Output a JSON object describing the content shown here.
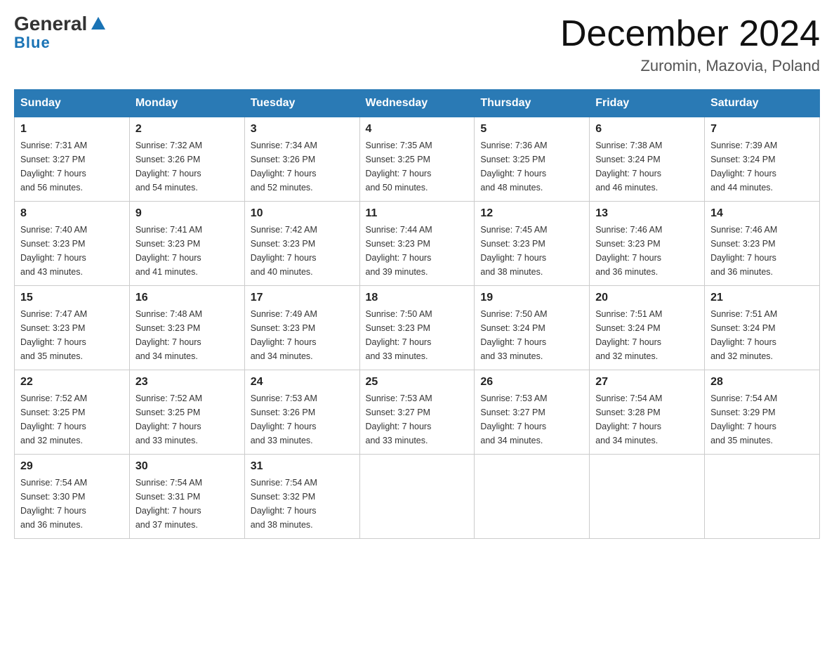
{
  "logo": {
    "general": "General",
    "triangle": "▶",
    "blue": "Blue"
  },
  "title": {
    "month_year": "December 2024",
    "location": "Zuromin, Mazovia, Poland"
  },
  "headers": [
    "Sunday",
    "Monday",
    "Tuesday",
    "Wednesday",
    "Thursday",
    "Friday",
    "Saturday"
  ],
  "weeks": [
    [
      {
        "day": "1",
        "sunrise": "7:31 AM",
        "sunset": "3:27 PM",
        "daylight": "7 hours and 56 minutes."
      },
      {
        "day": "2",
        "sunrise": "7:32 AM",
        "sunset": "3:26 PM",
        "daylight": "7 hours and 54 minutes."
      },
      {
        "day": "3",
        "sunrise": "7:34 AM",
        "sunset": "3:26 PM",
        "daylight": "7 hours and 52 minutes."
      },
      {
        "day": "4",
        "sunrise": "7:35 AM",
        "sunset": "3:25 PM",
        "daylight": "7 hours and 50 minutes."
      },
      {
        "day": "5",
        "sunrise": "7:36 AM",
        "sunset": "3:25 PM",
        "daylight": "7 hours and 48 minutes."
      },
      {
        "day": "6",
        "sunrise": "7:38 AM",
        "sunset": "3:24 PM",
        "daylight": "7 hours and 46 minutes."
      },
      {
        "day": "7",
        "sunrise": "7:39 AM",
        "sunset": "3:24 PM",
        "daylight": "7 hours and 44 minutes."
      }
    ],
    [
      {
        "day": "8",
        "sunrise": "7:40 AM",
        "sunset": "3:23 PM",
        "daylight": "7 hours and 43 minutes."
      },
      {
        "day": "9",
        "sunrise": "7:41 AM",
        "sunset": "3:23 PM",
        "daylight": "7 hours and 41 minutes."
      },
      {
        "day": "10",
        "sunrise": "7:42 AM",
        "sunset": "3:23 PM",
        "daylight": "7 hours and 40 minutes."
      },
      {
        "day": "11",
        "sunrise": "7:44 AM",
        "sunset": "3:23 PM",
        "daylight": "7 hours and 39 minutes."
      },
      {
        "day": "12",
        "sunrise": "7:45 AM",
        "sunset": "3:23 PM",
        "daylight": "7 hours and 38 minutes."
      },
      {
        "day": "13",
        "sunrise": "7:46 AM",
        "sunset": "3:23 PM",
        "daylight": "7 hours and 36 minutes."
      },
      {
        "day": "14",
        "sunrise": "7:46 AM",
        "sunset": "3:23 PM",
        "daylight": "7 hours and 36 minutes."
      }
    ],
    [
      {
        "day": "15",
        "sunrise": "7:47 AM",
        "sunset": "3:23 PM",
        "daylight": "7 hours and 35 minutes."
      },
      {
        "day": "16",
        "sunrise": "7:48 AM",
        "sunset": "3:23 PM",
        "daylight": "7 hours and 34 minutes."
      },
      {
        "day": "17",
        "sunrise": "7:49 AM",
        "sunset": "3:23 PM",
        "daylight": "7 hours and 34 minutes."
      },
      {
        "day": "18",
        "sunrise": "7:50 AM",
        "sunset": "3:23 PM",
        "daylight": "7 hours and 33 minutes."
      },
      {
        "day": "19",
        "sunrise": "7:50 AM",
        "sunset": "3:24 PM",
        "daylight": "7 hours and 33 minutes."
      },
      {
        "day": "20",
        "sunrise": "7:51 AM",
        "sunset": "3:24 PM",
        "daylight": "7 hours and 32 minutes."
      },
      {
        "day": "21",
        "sunrise": "7:51 AM",
        "sunset": "3:24 PM",
        "daylight": "7 hours and 32 minutes."
      }
    ],
    [
      {
        "day": "22",
        "sunrise": "7:52 AM",
        "sunset": "3:25 PM",
        "daylight": "7 hours and 32 minutes."
      },
      {
        "day": "23",
        "sunrise": "7:52 AM",
        "sunset": "3:25 PM",
        "daylight": "7 hours and 33 minutes."
      },
      {
        "day": "24",
        "sunrise": "7:53 AM",
        "sunset": "3:26 PM",
        "daylight": "7 hours and 33 minutes."
      },
      {
        "day": "25",
        "sunrise": "7:53 AM",
        "sunset": "3:27 PM",
        "daylight": "7 hours and 33 minutes."
      },
      {
        "day": "26",
        "sunrise": "7:53 AM",
        "sunset": "3:27 PM",
        "daylight": "7 hours and 34 minutes."
      },
      {
        "day": "27",
        "sunrise": "7:54 AM",
        "sunset": "3:28 PM",
        "daylight": "7 hours and 34 minutes."
      },
      {
        "day": "28",
        "sunrise": "7:54 AM",
        "sunset": "3:29 PM",
        "daylight": "7 hours and 35 minutes."
      }
    ],
    [
      {
        "day": "29",
        "sunrise": "7:54 AM",
        "sunset": "3:30 PM",
        "daylight": "7 hours and 36 minutes."
      },
      {
        "day": "30",
        "sunrise": "7:54 AM",
        "sunset": "3:31 PM",
        "daylight": "7 hours and 37 minutes."
      },
      {
        "day": "31",
        "sunrise": "7:54 AM",
        "sunset": "3:32 PM",
        "daylight": "7 hours and 38 minutes."
      },
      null,
      null,
      null,
      null
    ]
  ],
  "labels": {
    "sunrise": "Sunrise:",
    "sunset": "Sunset:",
    "daylight": "Daylight:"
  }
}
